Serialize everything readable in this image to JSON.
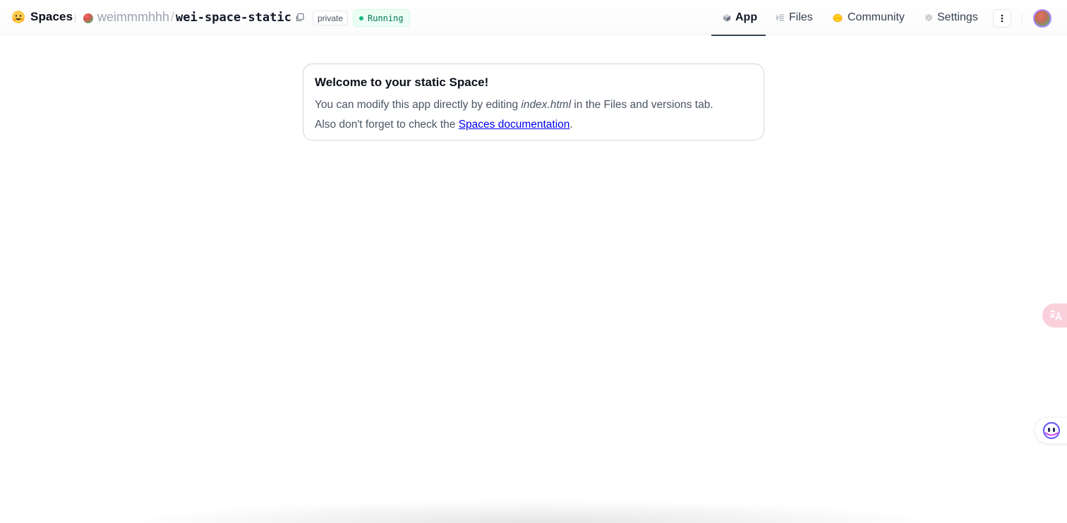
{
  "header": {
    "brand_label": "Spaces",
    "owner": "weimmmhhh",
    "separator": "/",
    "repo_name": "wei-space-static",
    "visibility_badge": "private",
    "status_badge": "Running",
    "colors": {
      "status_green": "#10b981",
      "active_tab_underline": "#374151"
    }
  },
  "tabs": [
    {
      "label": "App",
      "icon": "cube-icon",
      "active": true
    },
    {
      "label": "Files",
      "icon": "files-icon",
      "active": false
    },
    {
      "label": "Community",
      "icon": "hug-icon",
      "active": false
    },
    {
      "label": "Settings",
      "icon": "gear-icon",
      "active": false
    }
  ],
  "main": {
    "card_title": "Welcome to your static Space!",
    "line1_before": "You can modify this app directly by editing ",
    "line1_em": "index.html",
    "line1_after": " in the Files and versions tab.",
    "line2_before": "Also don't forget to check the ",
    "line2_link": "Spaces documentation",
    "line2_after": "."
  },
  "floating": {
    "translate_icon": "translate-icon",
    "assistant_icon": "assistant-icon"
  }
}
